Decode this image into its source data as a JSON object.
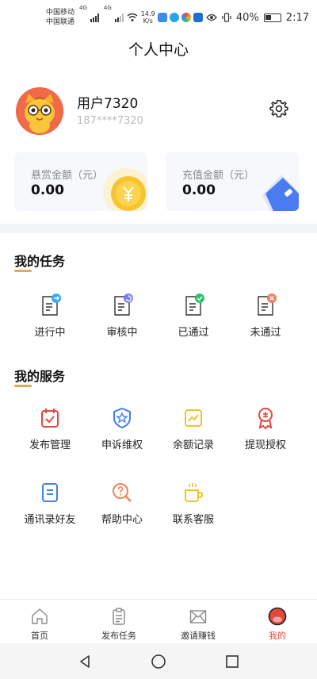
{
  "status": {
    "carrier1": "中国移动",
    "carrier2": "中国联通",
    "net1": "4G",
    "net2": "4G",
    "speed_value": "14.9",
    "speed_unit": "K/s",
    "battery": "40%",
    "time": "2:17"
  },
  "header": {
    "title": "个人中心"
  },
  "profile": {
    "name": "用户7320",
    "phone": "187****7320"
  },
  "cards": [
    {
      "label": "悬赏金额（元）",
      "value": "0.00"
    },
    {
      "label": "充值金额（元）",
      "value": "0.00"
    }
  ],
  "tasks": {
    "title": "我的任务",
    "items": [
      {
        "label": "进行中"
      },
      {
        "label": "审核中"
      },
      {
        "label": "已通过"
      },
      {
        "label": "未通过"
      }
    ]
  },
  "services": {
    "title": "我的服务",
    "items": [
      {
        "label": "发布管理"
      },
      {
        "label": "申诉维权"
      },
      {
        "label": "余额记录"
      },
      {
        "label": "提现授权"
      },
      {
        "label": "通讯录好友"
      },
      {
        "label": "帮助中心"
      },
      {
        "label": "联系客服"
      }
    ]
  },
  "tabbar": {
    "items": [
      {
        "label": "首页"
      },
      {
        "label": "发布任务"
      },
      {
        "label": "邀请赚钱"
      },
      {
        "label": "我的"
      }
    ],
    "active_color": "#e0483b"
  },
  "colors": {
    "accent": "#e8a653",
    "brand_red": "#e0483b"
  }
}
